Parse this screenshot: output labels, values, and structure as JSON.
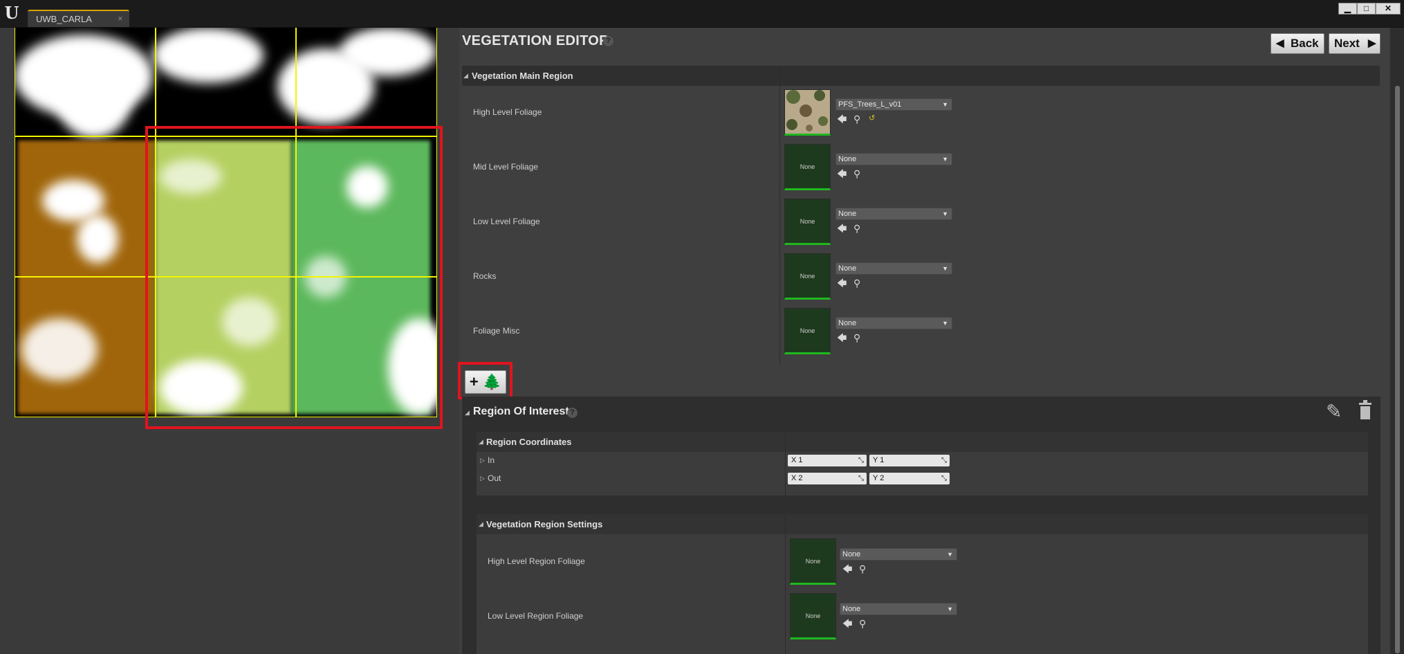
{
  "window": {
    "tab_label": "UWB_CARLA",
    "tab_close": "×",
    "minimize": "▁",
    "maximize": "□",
    "close": "✕",
    "logo": "U"
  },
  "map": {
    "colors": {
      "background": "#000000",
      "region_brown": "#a0650a",
      "region_lime": "#b4d060",
      "region_green": "#5cb85c",
      "grid": "#f4f400",
      "highlight": "#e0141e"
    }
  },
  "editor": {
    "title": "VEGETATION EDITOR",
    "help": "?",
    "back_label": "Back",
    "next_label": "Next"
  },
  "main_region": {
    "title": "Vegetation Main Region",
    "rows": [
      {
        "label": "High Level Foliage",
        "value": "PFS_Trees_L_v01",
        "thumb": ""
      },
      {
        "label": "Mid Level Foliage",
        "value": "None",
        "thumb": "None"
      },
      {
        "label": "Low Level Foliage",
        "value": "None",
        "thumb": "None"
      },
      {
        "label": "Rocks",
        "value": "None",
        "thumb": "None"
      },
      {
        "label": "Foliage Misc",
        "value": "None",
        "thumb": "None"
      }
    ]
  },
  "add_button": {
    "label": "+ 🌲"
  },
  "roi": {
    "title": "Region Of Interest",
    "help": "?",
    "coords_title": "Region Coordinates",
    "in_label": "In",
    "out_label": "Out",
    "in_x": "X  1",
    "in_y": "Y  1",
    "out_x": "X  2",
    "out_y": "Y  2",
    "settings_title": "Vegetation Region Settings",
    "settings_rows": [
      {
        "label": "High Level Region Foliage",
        "value": "None",
        "thumb": "None"
      },
      {
        "label": "Low Level Region Foliage",
        "value": "None",
        "thumb": "None"
      }
    ]
  }
}
